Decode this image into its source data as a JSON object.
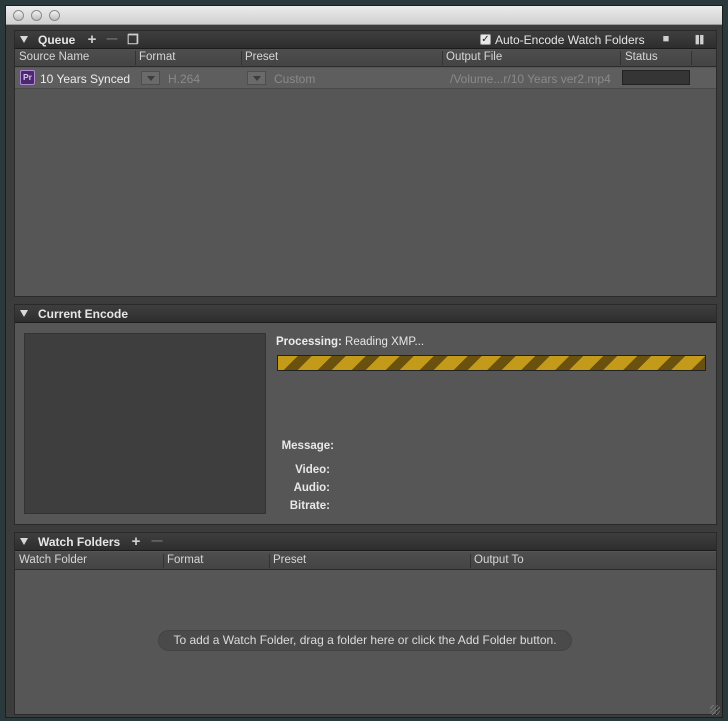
{
  "queue": {
    "title": "Queue",
    "auto_encode_label": "Auto-Encode Watch Folders",
    "columns": [
      "Source Name",
      "Format",
      "Preset",
      "Output File",
      "Status"
    ],
    "item": {
      "icon_text": "Pr",
      "source_name": "10 Years Synced",
      "format": "H.264",
      "preset": "Custom",
      "output_file": "/Volume...r/10 Years ver2.mp4"
    }
  },
  "current_encode": {
    "title": "Current Encode",
    "processing_label": "Processing:",
    "processing_value": "Reading XMP...",
    "progress": 1.0,
    "message_label": "Message:",
    "video_label": "Video:",
    "audio_label": "Audio:",
    "bitrate_label": "Bitrate:"
  },
  "watch_folders": {
    "title": "Watch Folders",
    "columns": [
      "Watch Folder",
      "Format",
      "Preset",
      "Output To"
    ],
    "hint": "To add a Watch Folder, drag a folder here or click the Add Folder button."
  },
  "icons": {
    "add": "+",
    "remove": "—",
    "duplicate": "❐",
    "stop": "■",
    "pause": "❚❚",
    "check": "✓"
  }
}
